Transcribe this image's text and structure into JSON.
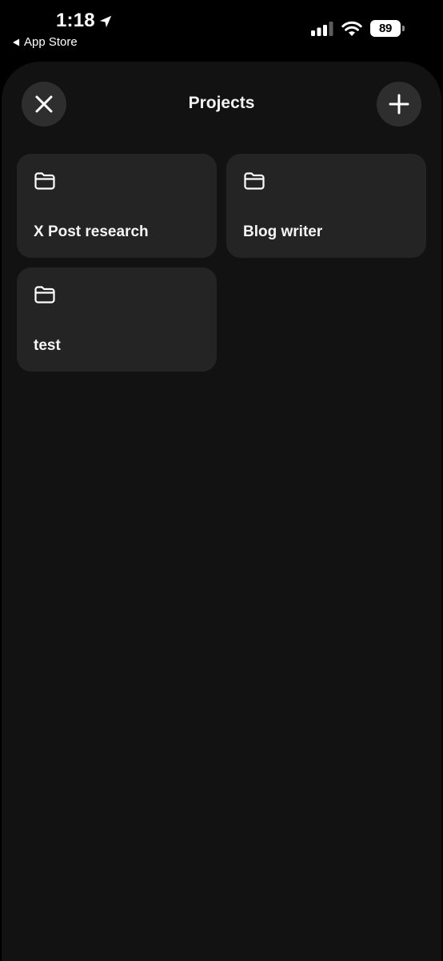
{
  "status_bar": {
    "time": "1:18",
    "back_app_label": "App Store",
    "battery_level": "89",
    "signal_bars_active": 3,
    "signal_bars_total": 4
  },
  "header": {
    "title": "Projects",
    "close_icon": "close-icon",
    "add_icon": "plus-icon"
  },
  "projects": [
    {
      "name": "X Post research",
      "icon": "folder-icon"
    },
    {
      "name": "Blog writer",
      "icon": "folder-icon"
    },
    {
      "name": "test",
      "icon": "folder-icon"
    }
  ],
  "colors": {
    "background": "#000000",
    "sheet": "#121212",
    "card": "#242424",
    "button": "#2e2e2e",
    "text": "#ffffff"
  }
}
